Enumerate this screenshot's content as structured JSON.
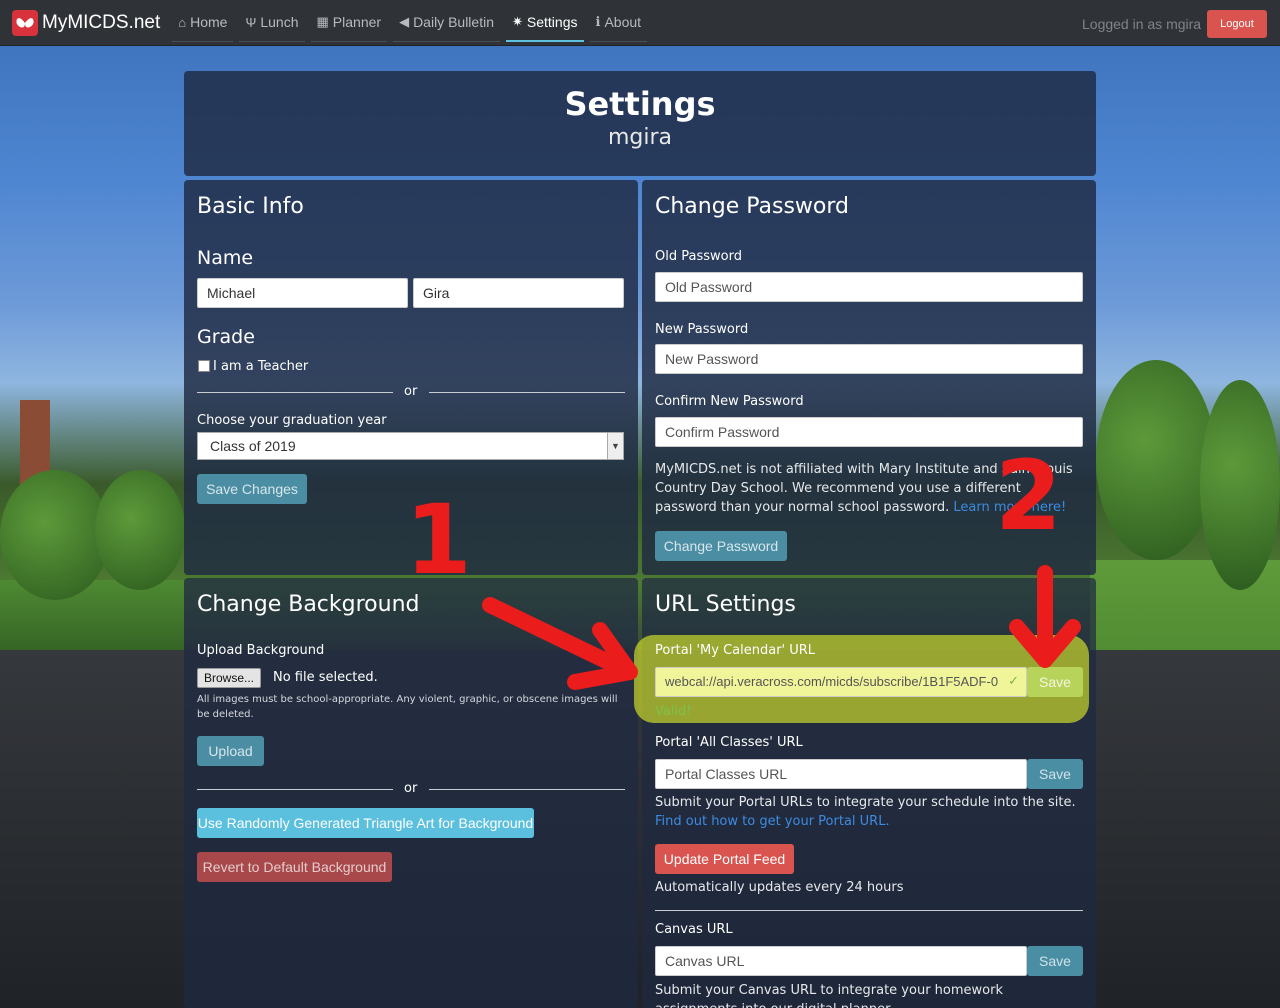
{
  "navbar": {
    "brand": "MyMICDS.net",
    "items": [
      {
        "label": "Home",
        "icon": "home-icon"
      },
      {
        "label": "Lunch",
        "icon": "fork-knife-icon"
      },
      {
        "label": "Planner",
        "icon": "calendar-icon"
      },
      {
        "label": "Daily Bulletin",
        "icon": "megaphone-icon"
      },
      {
        "label": "Settings",
        "icon": "gear-icon",
        "active": true
      },
      {
        "label": "About",
        "icon": "info-icon"
      }
    ],
    "logged_in": "Logged in as mgira",
    "logout": "Logout"
  },
  "header": {
    "title": "Settings",
    "username": "mgira"
  },
  "basic_info": {
    "title": "Basic Info",
    "name_label": "Name",
    "first_name": "Michael",
    "last_name": "Gira",
    "grade_label": "Grade",
    "teacher_label": "I am a Teacher",
    "or": "or",
    "grad_year_label": "Choose your graduation year",
    "grad_year_value": "Class of 2019",
    "save_button": "Save Changes"
  },
  "change_password": {
    "title": "Change Password",
    "old_label": "Old Password",
    "old_placeholder": "Old Password",
    "new_label": "New Password",
    "new_placeholder": "New Password",
    "confirm_label": "Confirm New Password",
    "confirm_placeholder": "Confirm Password",
    "disclaimer": "MyMICDS.net is not affiliated with Mary Institute and Saint Louis Country Day School. We recommend you use a different password than your normal school password.",
    "learn_more": "Learn more here!",
    "button": "Change Password"
  },
  "change_background": {
    "title": "Change Background",
    "upload_label": "Upload Background",
    "browse": "Browse...",
    "no_file": "No file selected.",
    "notice": "All images must be school-appropriate. Any violent, graphic, or obscene images will be deleted.",
    "upload_button": "Upload",
    "or": "or",
    "triangle_button": "Use Randomly Generated Triangle Art for Background",
    "revert_button": "Revert to Default Background"
  },
  "url_settings": {
    "title": "URL Settings",
    "calendar_label": "Portal 'My Calendar' URL",
    "calendar_value": "webcal://api.veracross.com/micds/subscribe/1B1F5ADF-0",
    "calendar_save": "Save",
    "valid_text": "Valid!",
    "classes_label": "Portal 'All Classes' URL",
    "classes_placeholder": "Portal Classes URL",
    "classes_save": "Save",
    "portal_help": "Submit your Portal URLs to integrate your schedule into the site.",
    "portal_help_link": "Find out how to get your Portal URL.",
    "update_button": "Update Portal Feed",
    "auto_update": "Automatically updates every 24 hours",
    "canvas_label": "Canvas URL",
    "canvas_placeholder": "Canvas URL",
    "canvas_save": "Save",
    "canvas_help": "Submit your Canvas URL to integrate your homework assignments into our digital planner."
  },
  "annotations": {
    "one": "1",
    "two": "2"
  },
  "colors": {
    "accent": "#5bc0de",
    "danger": "#d9534f",
    "highlight": "#e1f028",
    "annotation": "#ea1c1c"
  }
}
